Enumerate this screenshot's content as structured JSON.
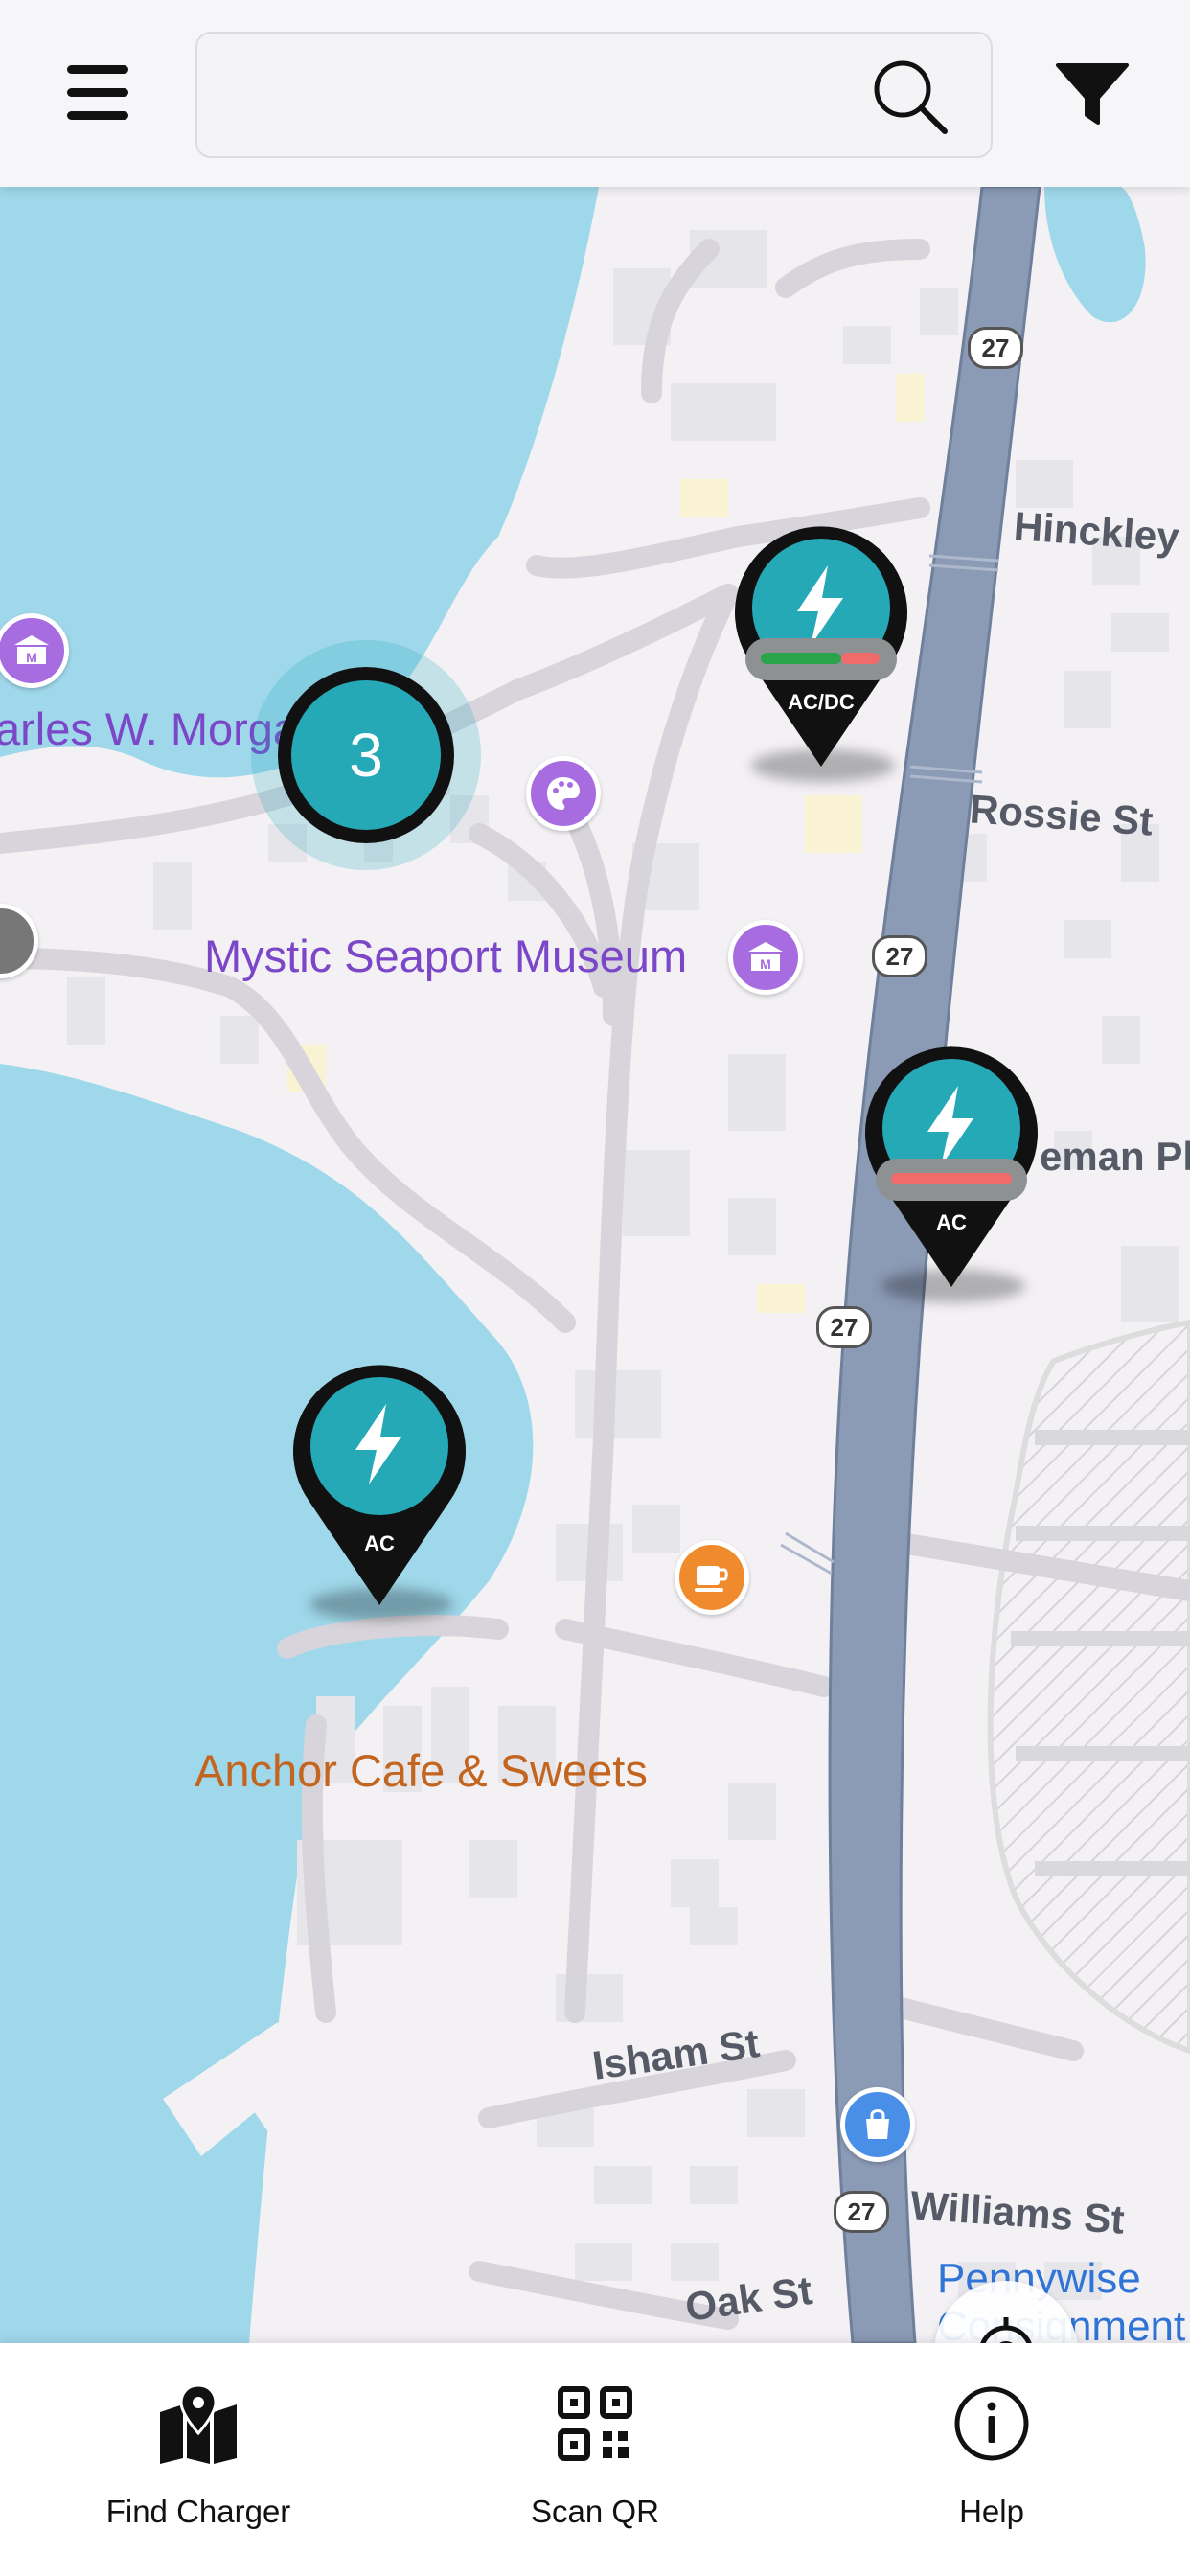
{
  "header": {
    "menu_icon": "hamburger-menu-icon",
    "search_placeholder": "",
    "search_value": "",
    "search_icon": "search-icon",
    "filter_icon": "filter-funnel-icon"
  },
  "map": {
    "labels": {
      "museum": "Mystic Seaport Museum",
      "morgan": "arles W. Morga",
      "anchor": "Anchor Cafe & Sweets",
      "pennywise_line1": "Pennywise",
      "pennywise_line2": "Consignment"
    },
    "streets": {
      "hinckley": "Hinckley",
      "rossie": "Rossie St",
      "coleman": "eman Pl",
      "isham": "Isham St",
      "williams": "Williams St",
      "oak": "Oak St"
    },
    "route_number": "27",
    "cluster": {
      "count": "3"
    },
    "chargers": [
      {
        "type": "AC/DC",
        "status": "partially-available"
      },
      {
        "type": "AC",
        "status": "unavailable"
      },
      {
        "type": "AC",
        "status": "no-status"
      }
    ],
    "colors": {
      "water": "#9fd8ea",
      "highway": "#8b9ab5",
      "pin_teal": "#25a9b7",
      "available": "#2aa34a",
      "unavailable": "#f06c6c",
      "poi_purple": "#a66ce0",
      "poi_orange": "#ef8b2c",
      "poi_blue": "#4a8fe7"
    }
  },
  "locate_icon": "crosshair-locate-icon",
  "bottom_nav": {
    "items": [
      {
        "label": "Find Charger",
        "icon": "map-pin-icon"
      },
      {
        "label": "Scan QR",
        "icon": "qr-code-icon"
      },
      {
        "label": "Help",
        "icon": "info-icon"
      }
    ]
  }
}
